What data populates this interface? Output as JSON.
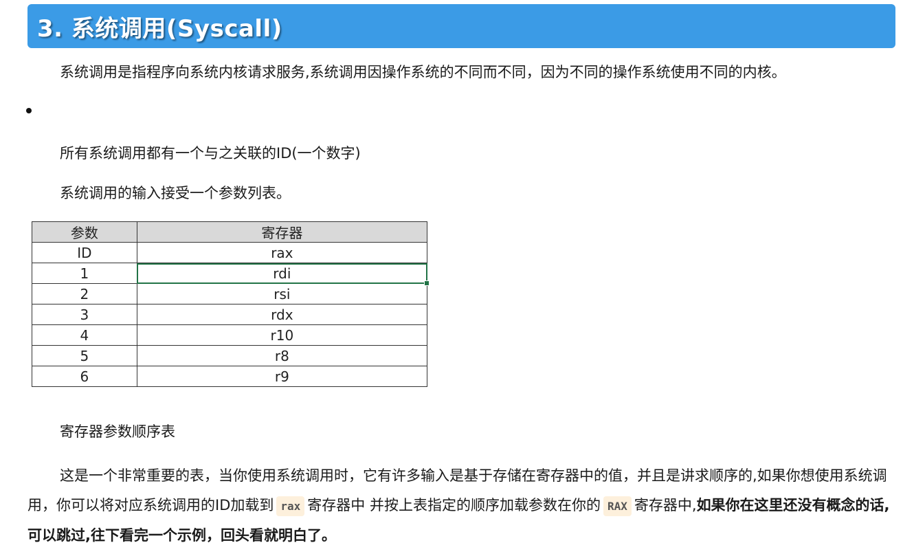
{
  "heading": {
    "title": "3. 系统调用(Syscall)"
  },
  "intro": "系统调用是指程序向系统内核请求服务,系统调用因操作系统的不同而不同，因为不同的操作系统使用不同的内核。",
  "points": [
    "所有系统调用都有一个与之关联的ID(一个数字)",
    "系统调用的输入接受一个参数列表。"
  ],
  "table": {
    "headers": [
      "参数",
      "寄存器"
    ],
    "rows": [
      [
        "ID",
        "rax"
      ],
      [
        "1",
        "rdi"
      ],
      [
        "2",
        "rsi"
      ],
      [
        "3",
        "rdx"
      ],
      [
        "4",
        "r10"
      ],
      [
        "5",
        "r8"
      ],
      [
        "6",
        "r9"
      ]
    ],
    "selected_row": 1
  },
  "caption": "寄存器参数顺序表",
  "explanation": {
    "part1": "这是一个非常重要的表，当你使用系统调用时，它有许多输入是基于存储在寄存器中的值，并且是讲求顺序的,如果你想使用系统调用，你可以将对应系统调用的ID加载到",
    "code1": "rax",
    "part2": "寄存器中 并按上表指定的顺序加载参数在你的",
    "code2": "RAX",
    "part3": "寄存器中,",
    "bold": "如果你在这里还没有概念的话,可以跳过,往下看完一个示例，回头看就明白了。"
  },
  "colors": {
    "heading_bg": "#3b9be6",
    "table_header_bg": "#d9d9d9",
    "selection": "#217346",
    "code_bg": "#fdf0dc"
  }
}
